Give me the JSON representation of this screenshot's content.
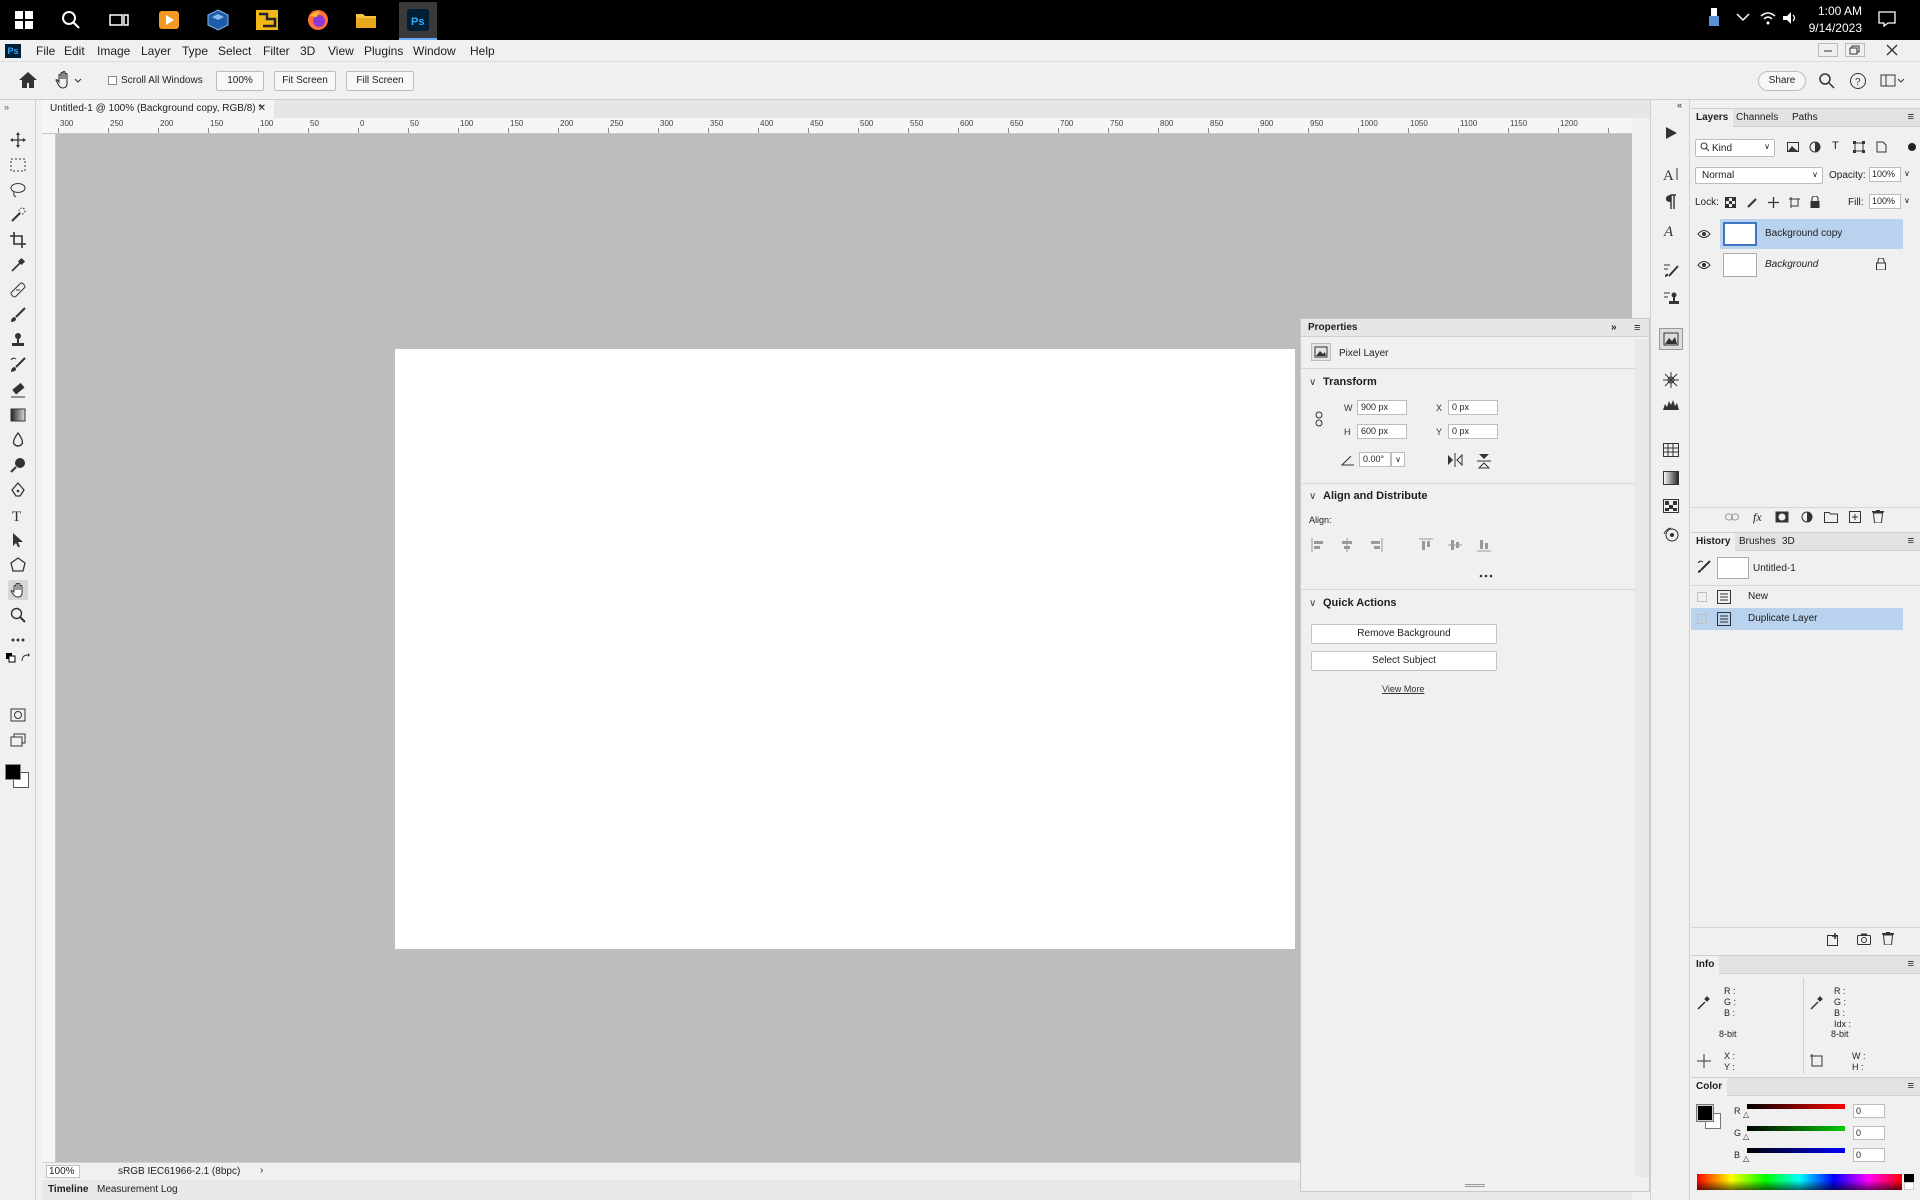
{
  "taskbar": {
    "icons": [
      "windows-start-icon",
      "search-icon",
      "task-view-icon",
      "media-player-icon",
      "virtualbox-icon",
      "app-icon",
      "firefox-icon",
      "file-explorer-icon",
      "photoshop-icon"
    ],
    "time": "1:00 AM",
    "date": "9/14/2023"
  },
  "menubar": {
    "app_logo": "Ps",
    "items": [
      "File",
      "Edit",
      "Image",
      "Layer",
      "Type",
      "Select",
      "Filter",
      "3D",
      "View",
      "Plugins",
      "Window",
      "Help"
    ]
  },
  "options_bar": {
    "scroll_all_windows": "Scroll All Windows",
    "zoom_value": "100%",
    "fit_screen": "Fit Screen",
    "fill_screen": "Fill Screen",
    "share": "Share"
  },
  "document": {
    "tab_title": "Untitled-1 @ 100% (Background copy, RGB/8) *",
    "zoom": "100%",
    "color_profile": "sRGB IEC61966-2.1 (8bpc)"
  },
  "ruler": {
    "labels": [
      "300",
      "250",
      "200",
      "150",
      "100",
      "50",
      "0",
      "50",
      "100",
      "150",
      "200",
      "250",
      "300",
      "350",
      "400",
      "450",
      "500",
      "550",
      "600",
      "650",
      "700",
      "750",
      "800",
      "850",
      "900",
      "950",
      "1000",
      "1050",
      "1100",
      "1150",
      "1200"
    ]
  },
  "bottom_tabs": [
    "Timeline",
    "Measurement Log"
  ],
  "properties": {
    "title": "Properties",
    "kind": "Pixel Layer",
    "transform": {
      "title": "Transform",
      "w_label": "W",
      "w": "900 px",
      "h_label": "H",
      "h": "600 px",
      "x_label": "X",
      "x": "0 px",
      "y_label": "Y",
      "y": "0 px",
      "angle": "0.00°"
    },
    "align": {
      "title": "Align and Distribute",
      "label": "Align:"
    },
    "quick_actions": {
      "title": "Quick Actions",
      "remove_background": "Remove Background",
      "select_subject": "Select Subject",
      "view_more": "View More"
    }
  },
  "layers_panel": {
    "tabs": [
      "Layers",
      "Channels",
      "Paths"
    ],
    "filter_kind": "Kind",
    "blend_mode": "Normal",
    "opacity_label": "Opacity:",
    "opacity": "100%",
    "lock_label": "Lock:",
    "fill_label": "Fill:",
    "fill": "100%",
    "layers": [
      {
        "name": "Background copy",
        "selected": true
      },
      {
        "name": "Background",
        "locked": true
      }
    ]
  },
  "history_panel": {
    "tabs": [
      "History",
      "Brushes",
      "3D"
    ],
    "snapshot": "Untitled-1",
    "steps": [
      "New",
      "Duplicate Layer"
    ]
  },
  "info_panel": {
    "title": "Info",
    "rgb_labels": [
      "R :",
      "G :",
      "B :"
    ],
    "rgb_labels2": [
      "R :",
      "G :",
      "B :",
      "Idx :"
    ],
    "bit_depth": "8-bit",
    "xy_labels": [
      "X :",
      "Y :"
    ],
    "wh_labels": [
      "W :",
      "H :"
    ]
  },
  "color_panel": {
    "title": "Color",
    "channels": [
      {
        "label": "R",
        "value": "0"
      },
      {
        "label": "G",
        "value": "0"
      },
      {
        "label": "B",
        "value": "0"
      }
    ]
  },
  "colors": {
    "accent_selected": "#b9d2ee",
    "annotation_arrow": "#e11b1b",
    "canvas_bg": "#bdbdbd",
    "foreground": "#000000",
    "background": "#ffffff"
  }
}
